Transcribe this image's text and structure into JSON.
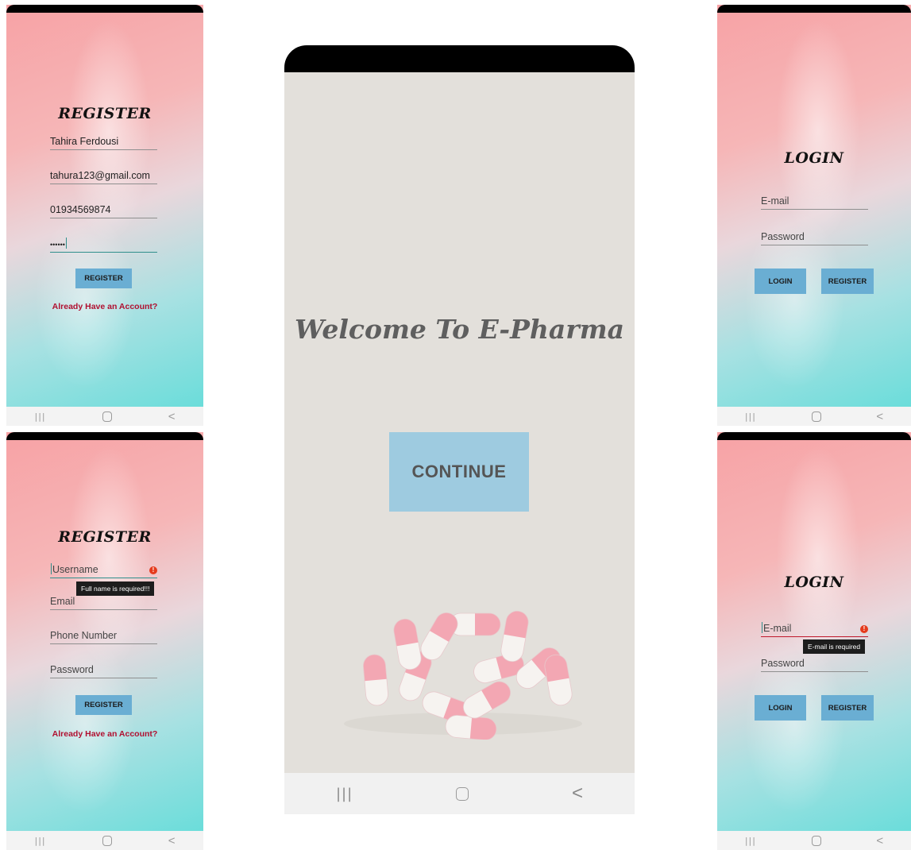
{
  "nav": {
    "recent": "|||",
    "back": "<"
  },
  "register_filled": {
    "title": "REGISTER",
    "name_value": "Tahira Ferdousi",
    "email_value": "tahura123@gmail.com",
    "phone_value": "01934569874",
    "password_value": "••••••",
    "button": "REGISTER",
    "link": "Already Have an Account?"
  },
  "register_error": {
    "title": "REGISTER",
    "username_placeholder": "Username",
    "error_text": "Full name is required!!!",
    "email_placeholder": "Email",
    "phone_placeholder": "Phone Number",
    "password_placeholder": "Password",
    "button": "REGISTER",
    "link": "Already Have an Account?"
  },
  "welcome": {
    "title": "Welcome To E-Pharma",
    "continue": "CONTINUE"
  },
  "login_empty": {
    "title": "LOGIN",
    "email_placeholder": "E-mail",
    "password_placeholder": "Password",
    "login_button": "LOGIN",
    "register_button": "REGISTER"
  },
  "login_error": {
    "title": "LOGIN",
    "email_placeholder": "E-mail",
    "error_text": "E-mail is required",
    "password_placeholder": "Password",
    "login_button": "LOGIN",
    "register_button": "REGISTER"
  },
  "colors": {
    "button": "#6aaed3",
    "link": "#b01030",
    "error": "#e53a1c",
    "continue_button": "#9ecbe0"
  },
  "icons": [
    "error-icon",
    "recent-apps-icon",
    "home-icon",
    "back-icon",
    "pills-image"
  ]
}
